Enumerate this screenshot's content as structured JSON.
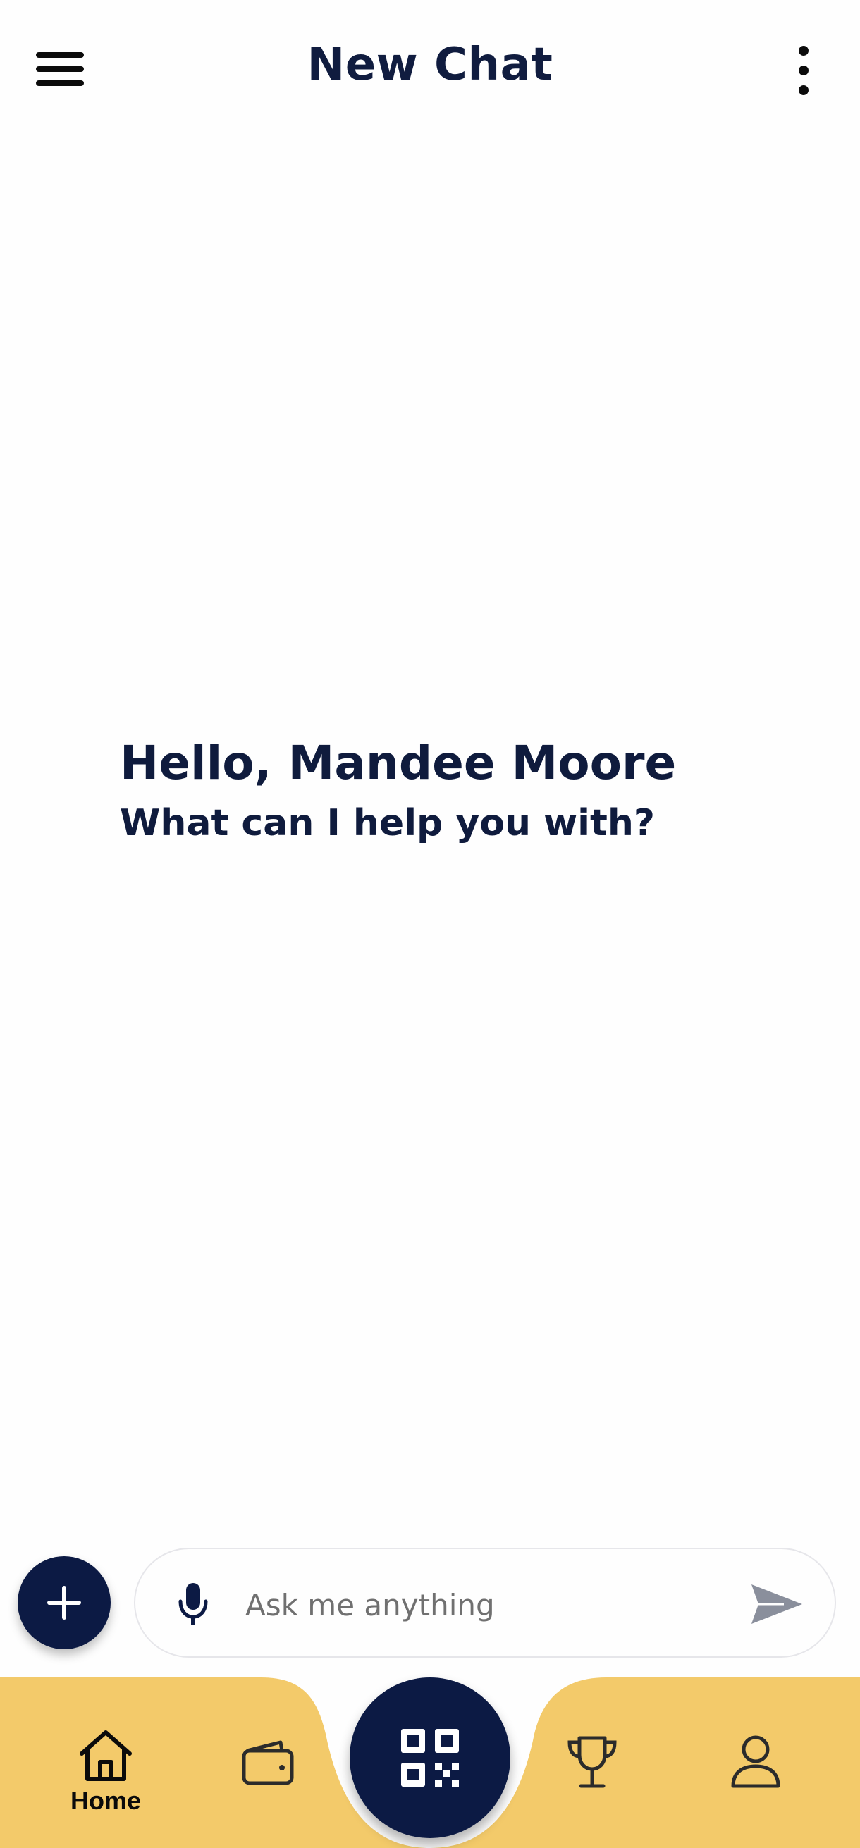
{
  "header": {
    "title": "New Chat",
    "menu_icon": "hamburger-menu-icon",
    "more_icon": "more-vertical-icon"
  },
  "greeting": {
    "title": "Hello, Mandee Moore",
    "subtitle": "What can I help you with?"
  },
  "composer": {
    "add_icon": "plus-icon",
    "mic_icon": "microphone-icon",
    "placeholder": "Ask me anything",
    "value": "",
    "send_icon": "send-icon"
  },
  "bottom_nav": {
    "items": [
      {
        "label": "Home",
        "icon": "home-icon",
        "active": true
      },
      {
        "label": "",
        "icon": "wallet-icon",
        "active": false
      },
      {
        "label": "",
        "icon": "qr-code-icon",
        "active": false
      },
      {
        "label": "",
        "icon": "trophy-icon",
        "active": false
      },
      {
        "label": "",
        "icon": "profile-icon",
        "active": false
      }
    ]
  },
  "colors": {
    "primary_navy": "#0c1a44",
    "nav_yellow": "#f3ca6a",
    "text_dark": "#0f1b3d",
    "placeholder_gray": "#707070",
    "send_gray": "#8a8f9c"
  }
}
